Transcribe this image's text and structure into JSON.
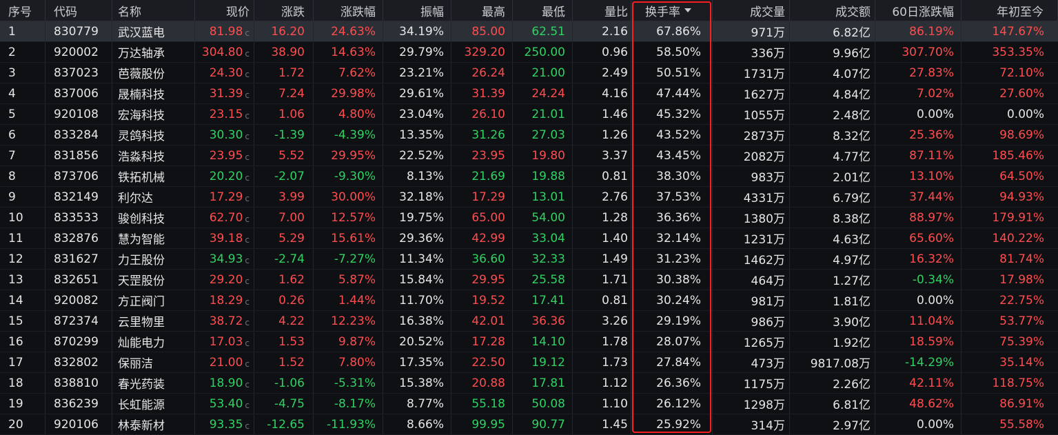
{
  "headers": {
    "idx": "序号",
    "code": "代码",
    "name": "名称",
    "price": "现价",
    "change": "涨跌",
    "change_pct": "涨跌幅",
    "amplitude": "振幅",
    "high": "最高",
    "low": "最低",
    "vol_ratio": "量比",
    "turnover": "换手率",
    "volume": "成交量",
    "amount": "成交额",
    "d60": "60日涨跌幅",
    "ytd": "年初至今"
  },
  "price_flag": "c",
  "colors": {
    "up": "#ff4d4f",
    "down": "#2fd263",
    "flat": "#e6e6e6",
    "highlight_box": "#ff1e1e"
  },
  "sort": {
    "column": "turnover",
    "direction": "desc"
  },
  "rows": [
    {
      "idx": "1",
      "code": "830779",
      "name": "武汉蓝电",
      "price": "81.98",
      "change": "16.20",
      "change_pct": "24.63%",
      "amplitude": "34.19%",
      "high": "85.00",
      "low": "62.51",
      "vol_ratio": "2.16",
      "turnover": "67.86%",
      "volume": "971万",
      "amount": "6.82亿",
      "d60": "86.19%",
      "ytd": "147.67%",
      "price_dir": "up",
      "chg_dir": "up",
      "high_dir": "up",
      "low_dir": "down",
      "d60_dir": "up",
      "ytd_dir": "up"
    },
    {
      "idx": "2",
      "code": "920002",
      "name": "万达轴承",
      "price": "304.80",
      "change": "38.90",
      "change_pct": "14.63%",
      "amplitude": "29.79%",
      "high": "329.20",
      "low": "250.00",
      "vol_ratio": "0.96",
      "turnover": "58.50%",
      "volume": "336万",
      "amount": "9.96亿",
      "d60": "307.70%",
      "ytd": "353.35%",
      "price_dir": "up",
      "chg_dir": "up",
      "high_dir": "up",
      "low_dir": "down",
      "d60_dir": "up",
      "ytd_dir": "up"
    },
    {
      "idx": "3",
      "code": "837023",
      "name": "芭薇股份",
      "price": "24.30",
      "change": "1.72",
      "change_pct": "7.62%",
      "amplitude": "23.21%",
      "high": "26.24",
      "low": "21.00",
      "vol_ratio": "2.49",
      "turnover": "50.51%",
      "volume": "1731万",
      "amount": "4.07亿",
      "d60": "27.83%",
      "ytd": "72.10%",
      "price_dir": "up",
      "chg_dir": "up",
      "high_dir": "up",
      "low_dir": "down",
      "d60_dir": "up",
      "ytd_dir": "up"
    },
    {
      "idx": "4",
      "code": "837006",
      "name": "晟楠科技",
      "price": "31.39",
      "change": "7.24",
      "change_pct": "29.98%",
      "amplitude": "29.61%",
      "high": "31.39",
      "low": "24.24",
      "vol_ratio": "4.16",
      "turnover": "47.44%",
      "volume": "1627万",
      "amount": "4.84亿",
      "d60": "7.02%",
      "ytd": "27.60%",
      "price_dir": "up",
      "chg_dir": "up",
      "high_dir": "up",
      "low_dir": "up",
      "d60_dir": "up",
      "ytd_dir": "up"
    },
    {
      "idx": "5",
      "code": "920108",
      "name": "宏海科技",
      "price": "23.15",
      "change": "1.06",
      "change_pct": "4.80%",
      "amplitude": "23.04%",
      "high": "26.10",
      "low": "21.01",
      "vol_ratio": "1.46",
      "turnover": "45.32%",
      "volume": "1055万",
      "amount": "2.48亿",
      "d60": "0.00%",
      "ytd": "0.00%",
      "price_dir": "up",
      "chg_dir": "up",
      "high_dir": "up",
      "low_dir": "down",
      "d60_dir": "flat",
      "ytd_dir": "flat"
    },
    {
      "idx": "6",
      "code": "833284",
      "name": "灵鸽科技",
      "price": "30.30",
      "change": "-1.39",
      "change_pct": "-4.39%",
      "amplitude": "13.35%",
      "high": "31.26",
      "low": "27.03",
      "vol_ratio": "1.26",
      "turnover": "43.52%",
      "volume": "2873万",
      "amount": "8.32亿",
      "d60": "25.36%",
      "ytd": "98.69%",
      "price_dir": "down",
      "chg_dir": "down",
      "high_dir": "down",
      "low_dir": "down",
      "d60_dir": "up",
      "ytd_dir": "up"
    },
    {
      "idx": "7",
      "code": "831856",
      "name": "浩淼科技",
      "price": "23.95",
      "change": "5.52",
      "change_pct": "29.95%",
      "amplitude": "22.52%",
      "high": "23.95",
      "low": "19.80",
      "vol_ratio": "3.37",
      "turnover": "43.45%",
      "volume": "2082万",
      "amount": "4.77亿",
      "d60": "87.11%",
      "ytd": "185.46%",
      "price_dir": "up",
      "chg_dir": "up",
      "high_dir": "up",
      "low_dir": "up",
      "d60_dir": "up",
      "ytd_dir": "up"
    },
    {
      "idx": "8",
      "code": "873706",
      "name": "铁拓机械",
      "price": "20.20",
      "change": "-2.07",
      "change_pct": "-9.30%",
      "amplitude": "8.13%",
      "high": "21.69",
      "low": "19.88",
      "vol_ratio": "0.81",
      "turnover": "38.30%",
      "volume": "983万",
      "amount": "2.01亿",
      "d60": "13.10%",
      "ytd": "64.50%",
      "price_dir": "down",
      "chg_dir": "down",
      "high_dir": "down",
      "low_dir": "down",
      "d60_dir": "up",
      "ytd_dir": "up"
    },
    {
      "idx": "9",
      "code": "832149",
      "name": "利尔达",
      "price": "17.29",
      "change": "3.99",
      "change_pct": "30.00%",
      "amplitude": "32.18%",
      "high": "17.29",
      "low": "13.01",
      "vol_ratio": "2.76",
      "turnover": "37.53%",
      "volume": "4331万",
      "amount": "6.79亿",
      "d60": "37.44%",
      "ytd": "94.93%",
      "price_dir": "up",
      "chg_dir": "up",
      "high_dir": "up",
      "low_dir": "down",
      "d60_dir": "up",
      "ytd_dir": "up"
    },
    {
      "idx": "10",
      "code": "833533",
      "name": "骏创科技",
      "price": "62.70",
      "change": "7.00",
      "change_pct": "12.57%",
      "amplitude": "19.75%",
      "high": "65.00",
      "low": "54.00",
      "vol_ratio": "1.28",
      "turnover": "36.36%",
      "volume": "1380万",
      "amount": "8.38亿",
      "d60": "88.97%",
      "ytd": "179.91%",
      "price_dir": "up",
      "chg_dir": "up",
      "high_dir": "up",
      "low_dir": "down",
      "d60_dir": "up",
      "ytd_dir": "up"
    },
    {
      "idx": "11",
      "code": "832876",
      "name": "慧为智能",
      "price": "39.18",
      "change": "5.29",
      "change_pct": "15.61%",
      "amplitude": "29.36%",
      "high": "42.99",
      "low": "33.04",
      "vol_ratio": "1.40",
      "turnover": "32.14%",
      "volume": "1231万",
      "amount": "4.63亿",
      "d60": "65.60%",
      "ytd": "140.22%",
      "price_dir": "up",
      "chg_dir": "up",
      "high_dir": "up",
      "low_dir": "down",
      "d60_dir": "up",
      "ytd_dir": "up"
    },
    {
      "idx": "12",
      "code": "831627",
      "name": "力王股份",
      "price": "34.93",
      "change": "-2.74",
      "change_pct": "-7.27%",
      "amplitude": "11.34%",
      "high": "36.60",
      "low": "32.33",
      "vol_ratio": "1.49",
      "turnover": "31.23%",
      "volume": "1462万",
      "amount": "4.97亿",
      "d60": "16.32%",
      "ytd": "81.74%",
      "price_dir": "down",
      "chg_dir": "down",
      "high_dir": "down",
      "low_dir": "down",
      "d60_dir": "up",
      "ytd_dir": "up"
    },
    {
      "idx": "13",
      "code": "832651",
      "name": "天罡股份",
      "price": "29.20",
      "change": "1.62",
      "change_pct": "5.87%",
      "amplitude": "15.84%",
      "high": "29.95",
      "low": "25.58",
      "vol_ratio": "1.71",
      "turnover": "30.38%",
      "volume": "464万",
      "amount": "1.27亿",
      "d60": "-0.34%",
      "ytd": "17.98%",
      "price_dir": "up",
      "chg_dir": "up",
      "high_dir": "up",
      "low_dir": "down",
      "d60_dir": "down",
      "ytd_dir": "up"
    },
    {
      "idx": "14",
      "code": "920082",
      "name": "方正阀门",
      "price": "18.29",
      "change": "0.26",
      "change_pct": "1.44%",
      "amplitude": "11.70%",
      "high": "19.52",
      "low": "17.41",
      "vol_ratio": "0.81",
      "turnover": "30.24%",
      "volume": "981万",
      "amount": "1.81亿",
      "d60": "0.00%",
      "ytd": "22.75%",
      "price_dir": "up",
      "chg_dir": "up",
      "high_dir": "up",
      "low_dir": "down",
      "d60_dir": "flat",
      "ytd_dir": "up"
    },
    {
      "idx": "15",
      "code": "872374",
      "name": "云里物里",
      "price": "38.72",
      "change": "4.22",
      "change_pct": "12.23%",
      "amplitude": "16.38%",
      "high": "42.01",
      "low": "36.36",
      "vol_ratio": "3.26",
      "turnover": "29.19%",
      "volume": "986万",
      "amount": "3.90亿",
      "d60": "11.04%",
      "ytd": "53.77%",
      "price_dir": "up",
      "chg_dir": "up",
      "high_dir": "up",
      "low_dir": "up",
      "d60_dir": "up",
      "ytd_dir": "up"
    },
    {
      "idx": "16",
      "code": "870299",
      "name": "灿能电力",
      "price": "17.03",
      "change": "1.53",
      "change_pct": "9.87%",
      "amplitude": "20.52%",
      "high": "17.28",
      "low": "14.10",
      "vol_ratio": "1.78",
      "turnover": "28.07%",
      "volume": "1265万",
      "amount": "1.92亿",
      "d60": "18.59%",
      "ytd": "75.39%",
      "price_dir": "up",
      "chg_dir": "up",
      "high_dir": "up",
      "low_dir": "down",
      "d60_dir": "up",
      "ytd_dir": "up"
    },
    {
      "idx": "17",
      "code": "832802",
      "name": "保丽洁",
      "price": "21.00",
      "change": "1.52",
      "change_pct": "7.80%",
      "amplitude": "17.35%",
      "high": "22.50",
      "low": "19.12",
      "vol_ratio": "1.73",
      "turnover": "27.84%",
      "volume": "473万",
      "amount": "9817.08万",
      "d60": "-14.29%",
      "ytd": "35.14%",
      "price_dir": "up",
      "chg_dir": "up",
      "high_dir": "up",
      "low_dir": "down",
      "d60_dir": "down",
      "ytd_dir": "up"
    },
    {
      "idx": "18",
      "code": "838810",
      "name": "春光药装",
      "price": "18.90",
      "change": "-1.06",
      "change_pct": "-5.31%",
      "amplitude": "15.38%",
      "high": "20.88",
      "low": "17.81",
      "vol_ratio": "1.12",
      "turnover": "26.36%",
      "volume": "1175万",
      "amount": "2.26亿",
      "d60": "42.11%",
      "ytd": "118.75%",
      "price_dir": "down",
      "chg_dir": "down",
      "high_dir": "up",
      "low_dir": "down",
      "d60_dir": "up",
      "ytd_dir": "up"
    },
    {
      "idx": "19",
      "code": "836239",
      "name": "长虹能源",
      "price": "53.40",
      "change": "-4.75",
      "change_pct": "-8.17%",
      "amplitude": "8.77%",
      "high": "55.18",
      "low": "50.08",
      "vol_ratio": "1.10",
      "turnover": "26.12%",
      "volume": "1298万",
      "amount": "6.81亿",
      "d60": "48.62%",
      "ytd": "86.91%",
      "price_dir": "down",
      "chg_dir": "down",
      "high_dir": "down",
      "low_dir": "down",
      "d60_dir": "up",
      "ytd_dir": "up"
    },
    {
      "idx": "20",
      "code": "920106",
      "name": "林泰新材",
      "price": "93.35",
      "change": "-12.65",
      "change_pct": "-11.93%",
      "amplitude": "8.66%",
      "high": "99.95",
      "low": "90.77",
      "vol_ratio": "1.45",
      "turnover": "25.92%",
      "volume": "314万",
      "amount": "2.97亿",
      "d60": "0.00%",
      "ytd": "55.58%",
      "price_dir": "down",
      "chg_dir": "down",
      "high_dir": "down",
      "low_dir": "down",
      "d60_dir": "flat",
      "ytd_dir": "up"
    }
  ]
}
